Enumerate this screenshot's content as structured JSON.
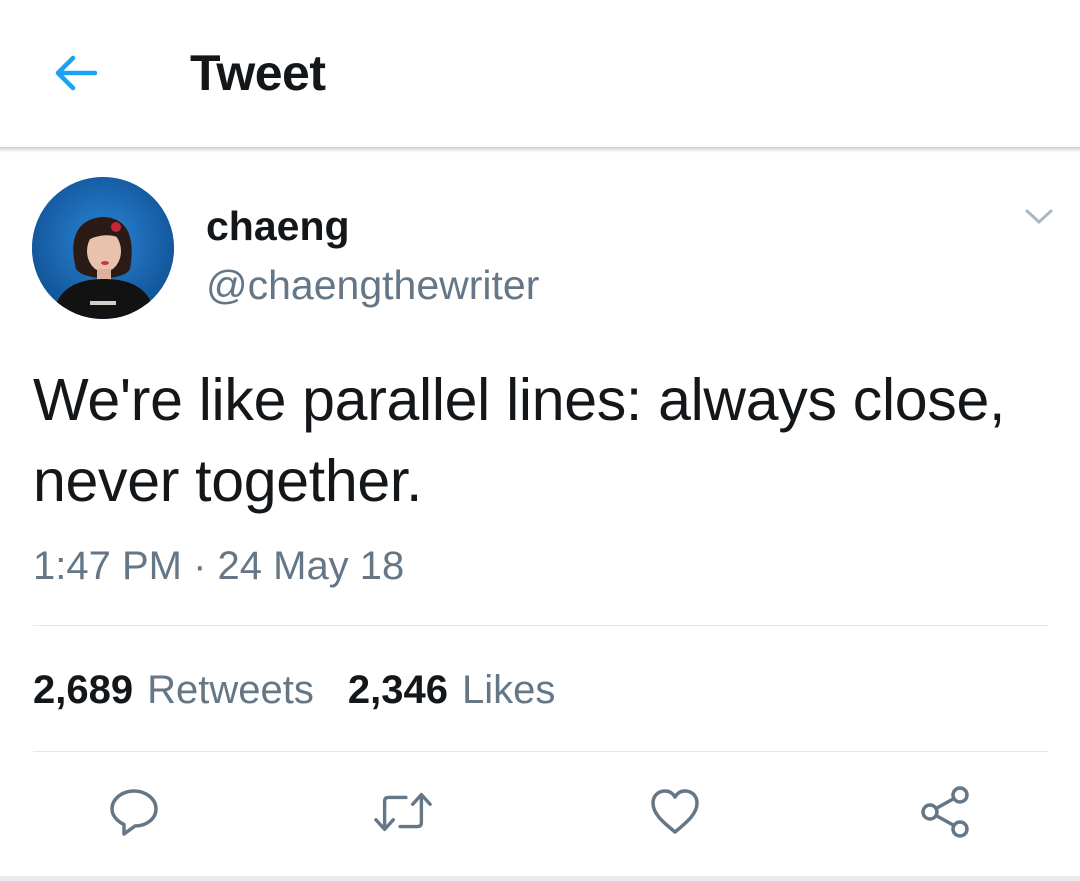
{
  "header": {
    "title": "Tweet",
    "back_icon": "arrow-left-icon",
    "accent_color": "#1da1f2"
  },
  "author": {
    "display_name": "chaeng",
    "handle": "@chaengthewriter",
    "avatar_icon": "user-avatar-photo",
    "menu_icon": "chevron-down-icon"
  },
  "tweet": {
    "text": "We're like parallel lines: always close, never together.",
    "timestamp": "1:47 PM · 24 May 18"
  },
  "stats": {
    "retweets_count": "2,689",
    "retweets_label": "Retweets",
    "likes_count": "2,346",
    "likes_label": "Likes"
  },
  "actions": {
    "reply_icon": "reply-icon",
    "retweet_icon": "retweet-icon",
    "like_icon": "heart-icon",
    "share_icon": "share-icon",
    "icon_color": "#657786"
  }
}
